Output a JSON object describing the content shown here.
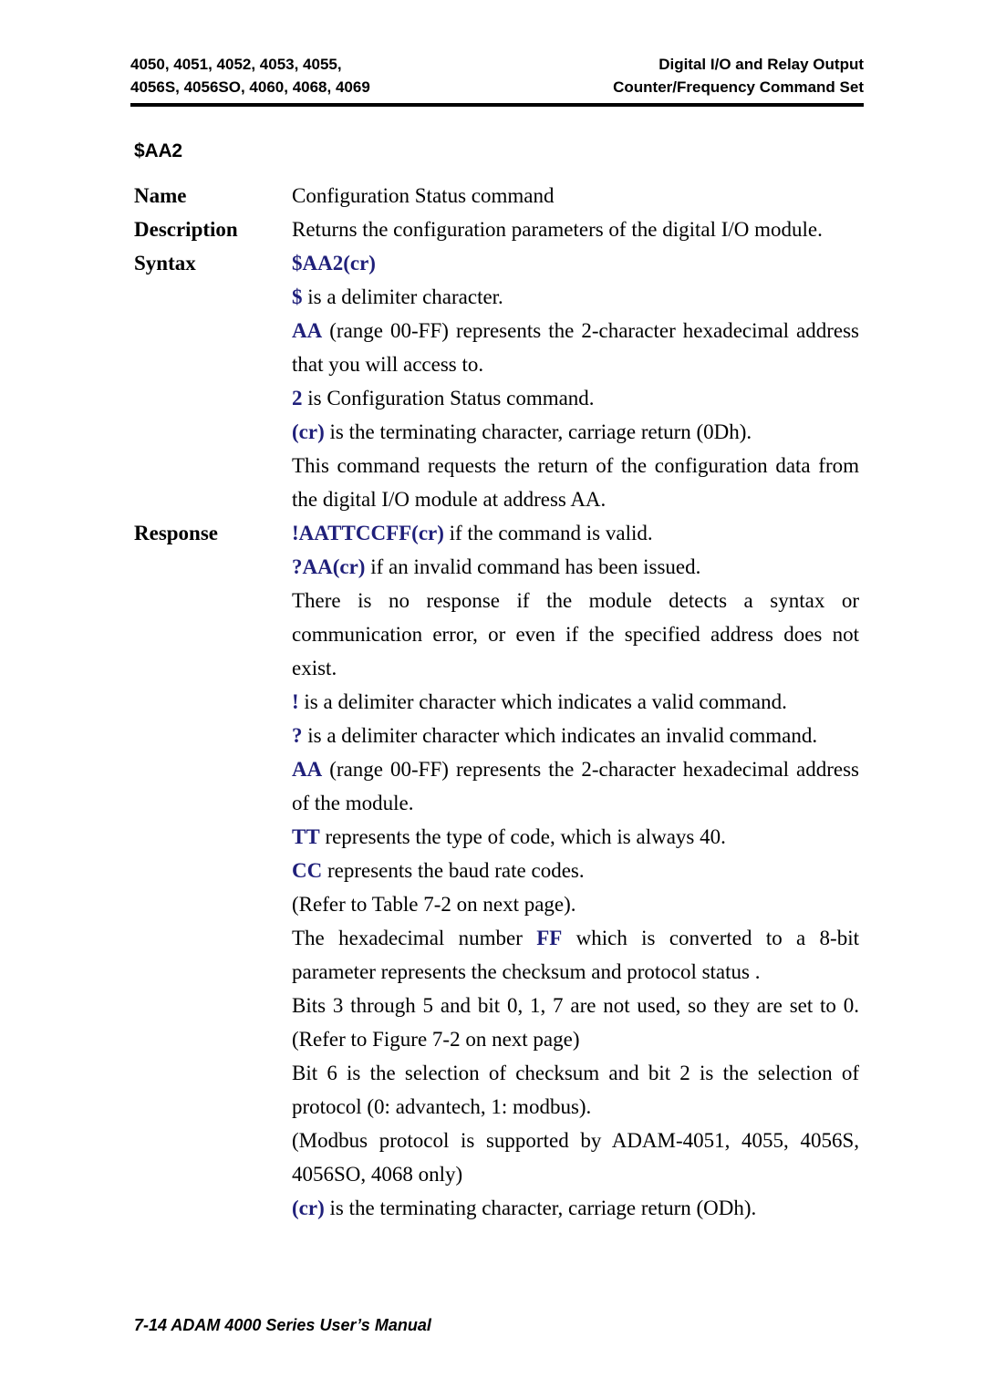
{
  "header": {
    "left": "4050, 4051, 4052, 4053, 4055,\n4056S, 4056SO, 4060, 4068, 4069",
    "right": "Digital I/O and Relay Output\nCounter/Frequency Command Set"
  },
  "command": {
    "title": "$AA2"
  },
  "labels": {
    "name": "Name",
    "description": "Description",
    "syntax": "Syntax",
    "response": "Response"
  },
  "name_section": {
    "text": "Configuration Status command"
  },
  "description_section": {
    "text": "Returns the configuration parameters of the digital I/O module."
  },
  "syntax_section": {
    "command": "$AA2(cr)",
    "lines": [
      {
        "code": "$",
        "rest": " is a delimiter character."
      },
      {
        "code": "AA",
        "rest": " (range 00-FF) represents the 2-character hexadecimal address that you will access to."
      },
      {
        "code": "2",
        "rest": " is Configuration Status command."
      },
      {
        "code": "(cr)",
        "rest": " is the terminating character, carriage return (0Dh)."
      }
    ],
    "note": "This command requests the return of the configuration data from the digital I/O module at address AA."
  },
  "response_section": {
    "valid": {
      "code": "!AATTCCFF(cr)",
      "rest": " if the command is valid."
    },
    "invalid": {
      "code": "?AA(cr)",
      "rest": " if an invalid command has been issued."
    },
    "no_response": "There is no response if the module detects a syntax or communication error, or even if the specified address does not exist.",
    "lines": [
      {
        "code": "!",
        "rest": " is a delimiter character which indicates a valid command."
      },
      {
        "code": "?",
        "rest": " is a delimiter character which indicates an invalid command."
      },
      {
        "code": "AA",
        "rest": " (range 00-FF) represents the 2-character hexadecimal address of the module."
      },
      {
        "code": "TT",
        "rest": " represents the type of code, which is always 40."
      },
      {
        "code": "CC",
        "rest": " represents the baud rate codes."
      }
    ],
    "refer_table": "(Refer to Table 7-2 on next page).",
    "ff_prefix": "The hexadecimal number ",
    "ff_code": "FF",
    "ff_suffix": " which is converted to a 8-bit parameter represents the checksum and protocol status .",
    "bits_unused": "Bits 3 through 5 and bit 0, 1, 7 are not used, so they are set to 0. (Refer to Figure 7-2 on next page)",
    "bit_selection": "Bit 6 is the selection of checksum and bit 2 is the selection of protocol (0: advantech, 1: modbus).",
    "modbus_note": "(Modbus protocol is supported by ADAM-4051, 4055, 4056S, 4056SO, 4068 only)",
    "terminator": {
      "code": "(cr)",
      "rest": " is the terminating character, carriage return (ODh)."
    }
  },
  "footer": {
    "text": "7-14 ADAM 4000 Series User’s Manual"
  },
  "colors": {
    "accent_blue": "#1f1f7a",
    "text": "#000000",
    "background": "#ffffff"
  }
}
